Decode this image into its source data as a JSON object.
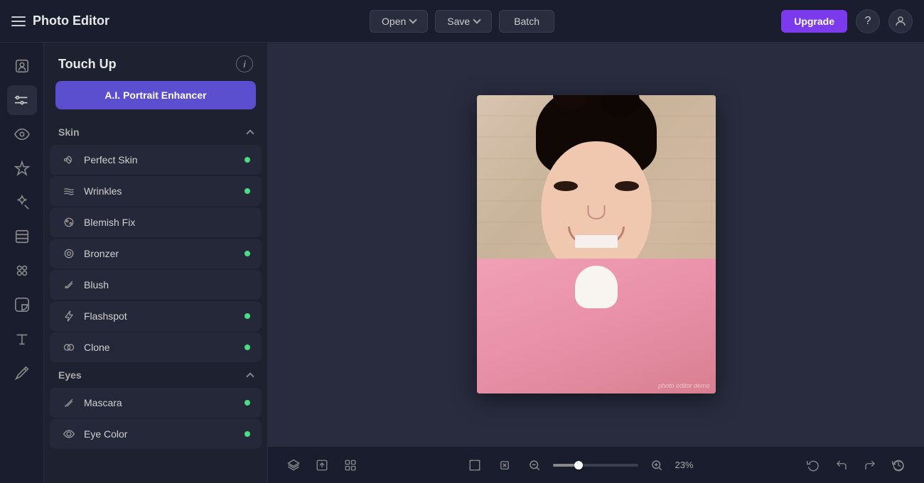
{
  "app": {
    "title": "Photo Editor"
  },
  "topbar": {
    "open_label": "Open",
    "save_label": "Save",
    "batch_label": "Batch",
    "upgrade_label": "Upgrade"
  },
  "tool_panel": {
    "title": "Touch Up",
    "ai_enhancer_label": "A.I. Portrait Enhancer",
    "info_label": "i",
    "skin_section": {
      "title": "Skin",
      "items": [
        {
          "label": "Perfect Skin",
          "icon": "✦",
          "has_dot": true
        },
        {
          "label": "Wrinkles",
          "icon": "≋",
          "has_dot": true
        },
        {
          "label": "Blemish Fix",
          "icon": "✦",
          "has_dot": false
        },
        {
          "label": "Bronzer",
          "icon": "◎",
          "has_dot": true
        },
        {
          "label": "Blush",
          "icon": "✏",
          "has_dot": false
        },
        {
          "label": "Flashspot",
          "icon": "⚡",
          "has_dot": true
        },
        {
          "label": "Clone",
          "icon": "⊕",
          "has_dot": true
        }
      ]
    },
    "eyes_section": {
      "title": "Eyes",
      "items": [
        {
          "label": "Mascara",
          "icon": "✏",
          "has_dot": true
        },
        {
          "label": "Eye Color",
          "icon": "◉",
          "has_dot": true
        }
      ]
    }
  },
  "canvas": {
    "zoom_percent": "23%"
  },
  "bottom_bar": {
    "zoom_value": "23%"
  }
}
